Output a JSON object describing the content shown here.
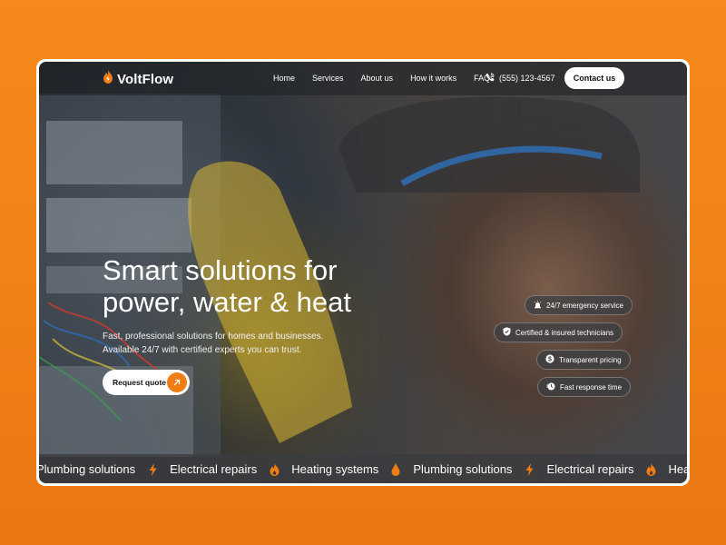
{
  "brand": {
    "name": "VoltFlow",
    "icon": "flame-bolt-icon",
    "accent": "#f07d14"
  },
  "nav": {
    "links": [
      "Home",
      "Services",
      "About us",
      "How it works",
      "FAQs"
    ],
    "phone": "(555) 123-4567",
    "phone_icon": "phone-icon",
    "contact_label": "Contact us"
  },
  "hero": {
    "headline_line1": "Smart solutions for",
    "headline_line2": "power, water & heat",
    "sub_line1": "Fast, professional solutions for homes and businesses.",
    "sub_line2": "Available 24/7 with certified experts you can trust.",
    "cta_label": "Request quote",
    "cta_icon": "arrow-up-right-icon"
  },
  "features": [
    {
      "label": "24/7 emergency service",
      "icon": "siren-icon"
    },
    {
      "label": "Certified & insured technicians",
      "icon": "shield-check-icon"
    },
    {
      "label": "Transparent pricing",
      "icon": "dollar-icon"
    },
    {
      "label": "Fast response time",
      "icon": "stopwatch-icon"
    }
  ],
  "ticker": {
    "items": [
      {
        "label": "Plumbing solutions",
        "icon": "bolt-icon"
      },
      {
        "label": "Electrical repairs",
        "icon": "flame-icon"
      },
      {
        "label": "Heating systems",
        "icon": "drop-icon"
      },
      {
        "label": "Plumbing solutions",
        "icon": "bolt-icon"
      },
      {
        "label": "Electrical repairs",
        "icon": "flame-icon"
      },
      {
        "label": "Heating systems",
        "icon": "none"
      }
    ]
  }
}
